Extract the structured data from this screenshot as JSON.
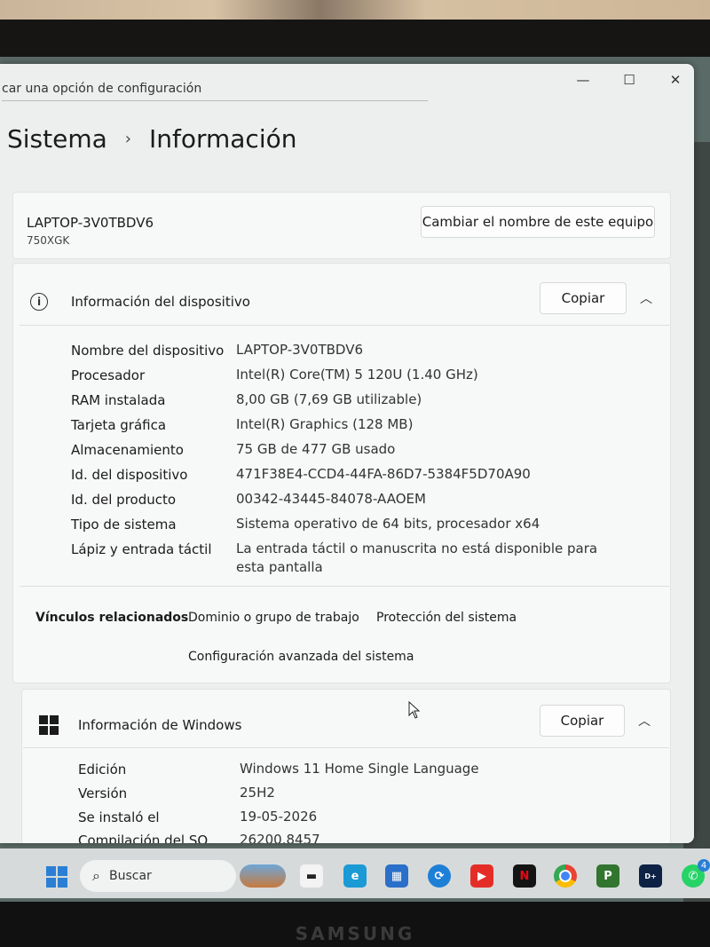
{
  "window": {
    "search_text": "car una opción de configuración",
    "controls": {
      "minimize": "—",
      "maximize": "☐",
      "close": "✕"
    }
  },
  "breadcrumb": {
    "parent": "Sistema",
    "current": "Información"
  },
  "pc": {
    "name": "LAPTOP-3V0TBDV6",
    "model": "750XGK",
    "rename_button": "Cambiar el nombre de este equipo"
  },
  "device_info": {
    "title": "Información del dispositivo",
    "copy_button": "Copiar",
    "specs": [
      {
        "label": "Nombre del dispositivo",
        "value": "LAPTOP-3V0TBDV6"
      },
      {
        "label": "Procesador",
        "value": "Intel(R) Core(TM) 5 120U (1.40 GHz)"
      },
      {
        "label": "RAM instalada",
        "value": "8,00 GB (7,69 GB utilizable)"
      },
      {
        "label": "Tarjeta gráfica",
        "value": "Intel(R) Graphics (128 MB)"
      },
      {
        "label": "Almacenamiento",
        "value": "75 GB de 477 GB usado"
      },
      {
        "label": "Id. del dispositivo",
        "value": "471F38E4-CCD4-44FA-86D7-5384F5D70A90"
      },
      {
        "label": "Id. del producto",
        "value": "00342-43445-84078-AAOEM"
      },
      {
        "label": "Tipo de sistema",
        "value": "Sistema operativo de 64 bits, procesador x64"
      },
      {
        "label": "Lápiz y entrada táctil",
        "value": "La entrada táctil o manuscrita no está disponible para esta pantalla"
      }
    ]
  },
  "related": {
    "title": "Vínculos relacionados",
    "links": [
      "Dominio o grupo de trabajo",
      "Protección del sistema",
      "Configuración avanzada del sistema"
    ]
  },
  "windows_info": {
    "title": "Información de Windows",
    "copy_button": "Copiar",
    "specs": [
      {
        "label": "Edición",
        "value": "Windows 11 Home Single Language"
      },
      {
        "label": "Versión",
        "value": "25H2"
      },
      {
        "label": "Se instaló el",
        "value": "19-05-2026"
      },
      {
        "label": "Compilación del SO",
        "value": "26200.8457"
      }
    ]
  },
  "taskbar": {
    "search_placeholder": "Buscar",
    "apps": [
      "landscape-widget",
      "dark-app",
      "edge",
      "store",
      "sync-app",
      "youtube",
      "netflix",
      "chrome",
      "project",
      "disney-plus",
      "whatsapp"
    ],
    "whatsapp_badge": "4"
  },
  "brand": "SAMSUNG"
}
